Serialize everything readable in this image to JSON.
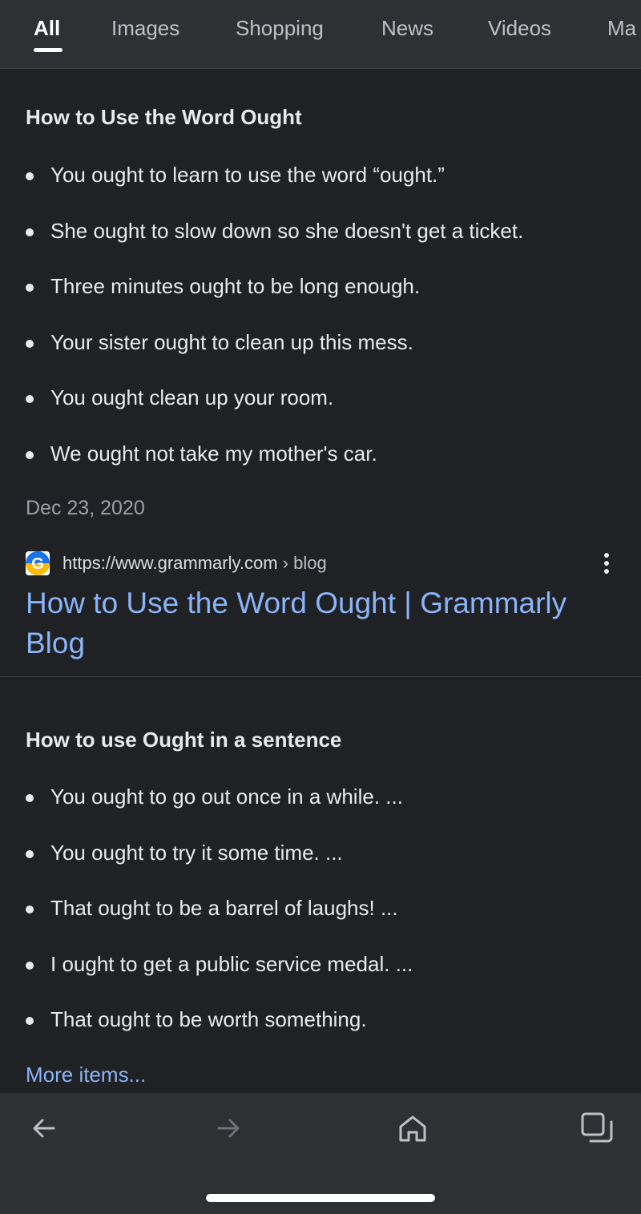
{
  "tabs": [
    {
      "label": "All",
      "active": true
    },
    {
      "label": "Images",
      "active": false
    },
    {
      "label": "Shopping",
      "active": false
    },
    {
      "label": "News",
      "active": false
    },
    {
      "label": "Videos",
      "active": false
    },
    {
      "label": "Ma",
      "active": false
    }
  ],
  "snippet1": {
    "heading": "How to Use the Word Ought",
    "items": [
      "You ought to learn to use the word “ought.”",
      "She ought to slow down so she doesn't get a ticket.",
      "Three minutes ought to be long enough.",
      "Your sister ought to clean up this mess.",
      "You ought clean up your room.",
      "We ought not take my mother's car."
    ],
    "date": "Dec 23, 2020"
  },
  "result1": {
    "favicon": "grammarly-g-icon",
    "url": "https://www.grammarly.com",
    "breadcrumb": "› blog",
    "title": "How to Use the Word Ought | Grammarly Blog",
    "favicon_colors": [
      "#1a73e8",
      "#fbbc04",
      "#ffffff"
    ]
  },
  "snippet2": {
    "heading": "How to use Ought in a sentence",
    "items": [
      "You ought to go out once in a while. ...",
      "You ought to try it some time. ...",
      "That ought to be a barrel of laughs! ...",
      "I ought to get a public service medal. ...",
      "That ought to be worth something."
    ],
    "more_items": "More items..."
  },
  "bottom_nav": {
    "icons": [
      "back-arrow-icon",
      "forward-arrow-icon",
      "home-icon",
      "tabs-icon"
    ]
  },
  "colors": {
    "background": "#202124",
    "bar": "#2f3033",
    "link": "#8ab4f8",
    "text": "#e8eaed",
    "muted": "#9aa0a6"
  }
}
